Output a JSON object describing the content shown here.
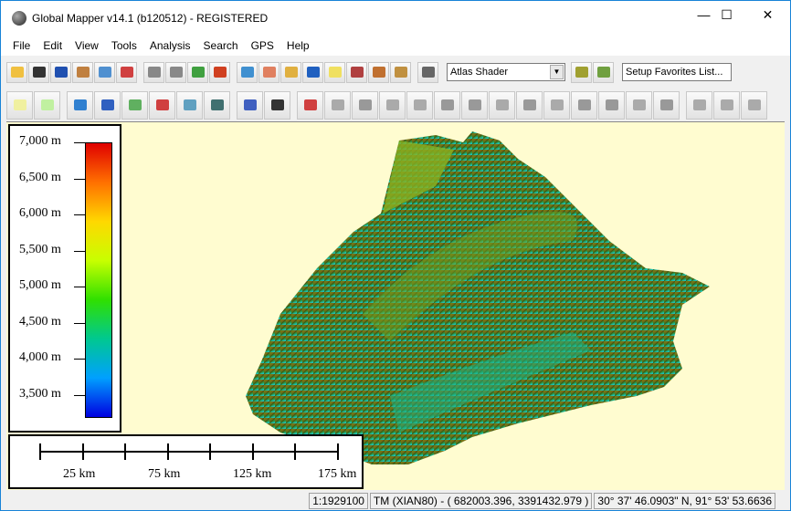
{
  "window": {
    "title": "Global Mapper v14.1 (b120512) - REGISTERED",
    "minimize": "—",
    "maximize": "☐",
    "close": "✕"
  },
  "menu": [
    "File",
    "Edit",
    "View",
    "Tools",
    "Analysis",
    "Search",
    "GPS",
    "Help"
  ],
  "toolbar1": {
    "buttons": [
      {
        "icon": "open-folder-icon",
        "color": "#f0c040"
      },
      {
        "icon": "save-icon",
        "color": "#333"
      },
      {
        "icon": "globe-icon",
        "color": "#2050b0"
      },
      {
        "icon": "map-layout-icon",
        "color": "#c08040"
      },
      {
        "icon": "overlay-control-icon",
        "color": "#5090d0"
      },
      {
        "icon": "configure-tools-icon",
        "color": "#d04040"
      },
      {
        "sep": true
      },
      {
        "icon": "zoom-in-icon",
        "color": "#888"
      },
      {
        "icon": "zoom-out-icon",
        "color": "#888"
      },
      {
        "icon": "zoom-to-layer-icon",
        "color": "#40a040"
      },
      {
        "icon": "home-icon",
        "color": "#d04020"
      },
      {
        "sep": true
      },
      {
        "icon": "zoom-tool-icon",
        "color": "#4090d0"
      },
      {
        "icon": "pan-hand-icon",
        "color": "#e08060"
      },
      {
        "icon": "measure-icon",
        "color": "#e0b040"
      },
      {
        "icon": "feature-info-icon",
        "color": "#2060c0"
      },
      {
        "icon": "path-profile-icon",
        "color": "#f0e060"
      },
      {
        "icon": "view-shed-icon",
        "color": "#b04040"
      },
      {
        "icon": "digitizer-icon",
        "color": "#c07030"
      },
      {
        "icon": "dropdown-arrow-icon",
        "color": "#c09040"
      },
      {
        "sep": true
      },
      {
        "icon": "3d-view-icon",
        "color": "#666"
      }
    ],
    "shader_select": "Atlas Shader",
    "shader_buttons": [
      {
        "icon": "shader-settings-icon",
        "color": "#a0a030"
      },
      {
        "icon": "3d-view-toggle-icon",
        "color": "#70a040"
      }
    ],
    "favorites": "Setup Favorites List..."
  },
  "toolbar2": {
    "buttons": [
      {
        "icon": "create-area-icon",
        "color": "#f0f0a0"
      },
      {
        "icon": "create-rectangle-icon",
        "color": "#c0f0a0"
      },
      {
        "sep": true
      },
      {
        "icon": "create-line-icon",
        "color": "#3080d0"
      },
      {
        "icon": "create-curve-icon",
        "color": "#3060c0"
      },
      {
        "icon": "create-box-icon",
        "color": "#60b060"
      },
      {
        "icon": "create-cogo-icon",
        "color": "#d04040"
      },
      {
        "icon": "create-circle-icon",
        "color": "#60a0c0"
      },
      {
        "icon": "create-grid-icon",
        "color": "#407070"
      },
      {
        "sep": true
      },
      {
        "icon": "create-points-icon",
        "color": "#4060c0"
      },
      {
        "icon": "insert-vertex-icon",
        "color": "#333"
      },
      {
        "sep": true
      },
      {
        "icon": "edit-vertices-icon",
        "color": "#d04040"
      },
      {
        "icon": "simplify-icon",
        "color": "#aaa"
      },
      {
        "icon": "combine-areas-icon",
        "color": "#999"
      },
      {
        "icon": "split-line-icon",
        "color": "#aaa"
      },
      {
        "icon": "join-lines-icon",
        "color": "#aaa"
      },
      {
        "icon": "cut-area-icon",
        "color": "#999"
      },
      {
        "icon": "buffer-icon",
        "color": "#999"
      },
      {
        "icon": "crop-icon",
        "color": "#aaa"
      },
      {
        "icon": "move-features-icon",
        "color": "#999"
      },
      {
        "icon": "rotate-icon",
        "color": "#aaa"
      },
      {
        "icon": "scale-features-icon",
        "color": "#999"
      },
      {
        "icon": "union-icon",
        "color": "#999"
      },
      {
        "icon": "intersect-icon",
        "color": "#aaa"
      },
      {
        "icon": "difference-icon",
        "color": "#999"
      },
      {
        "sep": true
      },
      {
        "icon": "undo-arrow-icon",
        "color": "#aaa"
      },
      {
        "icon": "up-arrow-icon",
        "color": "#aaa"
      },
      {
        "icon": "redo-arrow-icon",
        "color": "#aaa"
      }
    ]
  },
  "legend": {
    "labels": [
      "7,000 m",
      "6,500 m",
      "6,000 m",
      "5,500 m",
      "5,000 m",
      "4,500 m",
      "4,000 m",
      "3,500 m"
    ]
  },
  "scale_bar": {
    "labels": [
      "25 km",
      "75 km",
      "125 km",
      "175 km"
    ]
  },
  "map_background": "#fffcd0",
  "status": {
    "scale": "1:1929100",
    "projection": "TM (XIAN80) - ( 682003.396, 3391432.979 )",
    "latlon": "30° 37' 46.0903\" N, 91° 53' 53.6636"
  }
}
